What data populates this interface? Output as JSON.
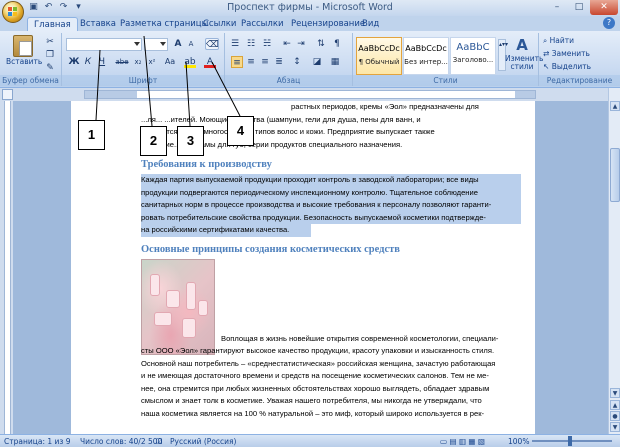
{
  "window": {
    "title": "Проспект фирмы - Microsoft Word",
    "controls": [
      "–",
      "□",
      "✕"
    ]
  },
  "tabs": [
    {
      "label": "Главная",
      "active": true
    },
    {
      "label": "Вставка"
    },
    {
      "label": "Разметка страницы"
    },
    {
      "label": "Ссылки"
    },
    {
      "label": "Рассылки"
    },
    {
      "label": "Рецензирование"
    },
    {
      "label": "Вид"
    }
  ],
  "ribbon": {
    "clipboard": {
      "paste_label": "Вставить",
      "group_label": "Буфер обмена"
    },
    "font": {
      "group_label": "Шрифт",
      "size_grow": "A",
      "size_shrink": "A",
      "aa_label": "Aa",
      "bold": "Ж",
      "italic": "К",
      "underline": "Ч",
      "strike": "abe",
      "subscript": "x₂",
      "superscript": "x²"
    },
    "paragraph": {
      "group_label": "Абзац"
    },
    "styles": {
      "group_label": "Стили",
      "items": [
        {
          "sample": "AaBbCcDc",
          "name": "¶ Обычный",
          "selected": true
        },
        {
          "sample": "AaBbCcDc",
          "name": "Без интер..."
        },
        {
          "sample": "AaBbC",
          "name": "Заголово..."
        }
      ],
      "change_styles": "Изменить стили"
    },
    "editing": {
      "group_label": "Редактирование",
      "find": "Найти",
      "replace": "Заменить",
      "select": "Выделить"
    }
  },
  "document": {
    "intro_lines": [
      "растных периодов, кремы «Эол» предназначены для",
      "...ля... ...ителей. Моющие средства (шампуни, гели для душа, пены для ванн, и",
      "А... ...ются с ...ом многообразия типов волос и кожи. Предприятие выпускает также",
      "... ...гигие... ...льзамы для губ, серии продуктов специального назначения."
    ],
    "heading1": "Требования к производству",
    "para1": [
      "Каждая партия выпускаемой продукции проходит контроль в заводской лаборатории; все виды",
      "продукции подвергаются периодическому инспекционному контролю. Тщательное соблюдение",
      "санитарных норм в процессе производства и высокие требования к персоналу позволяют гаранти-",
      "ровать потребительские свойства продукции. Безопасность выпускаемой косметики подтвержде-",
      "на российскими сертификатами качества."
    ],
    "heading2": "Основные принципы создания косметических средств",
    "para2_first": "Воплощая в жизнь новейшие открытия современной косметологии, специали-",
    "para2": [
      "сты ООО «Эол» гарантируют высокое качество продукции, красоту упаковки и изысканность стиля.",
      "Основной наш потребитель – «среднестатистическая» российская женщина, зачастую работающая",
      "и не имеющая достаточного времени и средств на посещение косметических салонов. Тем не ме-",
      "нее, она стремится при любых жизненных обстоятельствах хорошо выглядеть, обладает здравым",
      "смыслом и знает толк в косметике. Уважая нашего потребителя, мы никогда не утверждали, что",
      "наша косметика является на 100 % натуральной – это миф, который широко используется в рек-"
    ]
  },
  "callouts": [
    "1",
    "2",
    "3",
    "4"
  ],
  "statusbar": {
    "page": "Страница: 1 из 9",
    "words": "Число слов: 40/2 500",
    "language": "Русский (Россия)",
    "zoom": "100%"
  },
  "colors": {
    "heading": "#4f81bd",
    "selection": "#b9cfec",
    "ribbon": "#c9daf1"
  }
}
